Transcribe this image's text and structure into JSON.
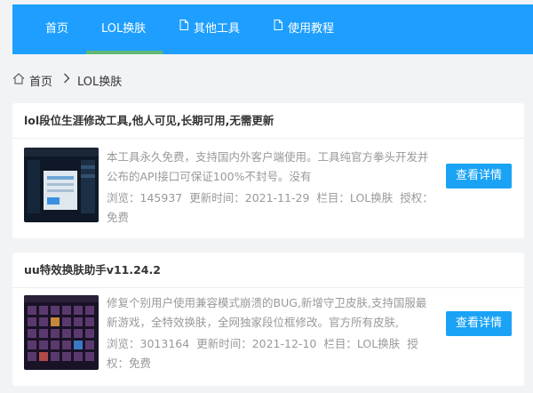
{
  "nav": {
    "items": [
      {
        "label": "首页"
      },
      {
        "label": "LOL换肤"
      },
      {
        "label": "其他工具",
        "icon": "document-icon"
      },
      {
        "label": "使用教程",
        "icon": "document-icon"
      }
    ],
    "colors": {
      "background": "#1e9fff",
      "active_bar": "#5fb878",
      "text": "#ffffff"
    }
  },
  "breadcrumb": {
    "home_icon": "home-icon",
    "home_label": "首页",
    "separator_icon": "chevron-right-icon",
    "current_label": "LOL换肤"
  },
  "posts": [
    {
      "title": "lol段位生涯修改工具,他人可见,长期可用,无需更新",
      "description": "本工具永久免费，支持国内外客户端使用。工具纯官方拳头开发并公布的API接口可保证100%不封号。没有",
      "views_label": "浏览：",
      "views": "145937",
      "updated_label": "更新时间：",
      "updated": "2021-11-29",
      "column_label": "栏目：",
      "column": "LOL换肤",
      "license_label": "授权：",
      "license": "免费",
      "button_label": "查看详情"
    },
    {
      "title": "uu特效换肤助手v11.24.2",
      "description": "修复个别用户使用兼容模式崩溃的BUG,新增守卫皮肤,支持国服最新游戏，全特效换肤，全网独家段位框修改。官方所有皮肤,",
      "views_label": "浏览：",
      "views": "3013164",
      "updated_label": "更新时间：",
      "updated": "2021-12-10",
      "column_label": "栏目：",
      "column": "LOL换肤",
      "license_label": "授权：",
      "license": "免费",
      "button_label": "查看详情"
    }
  ],
  "colors": {
    "page_bg": "#f2f3f5",
    "button": "#1aa3f5",
    "muted_text": "#999999"
  }
}
